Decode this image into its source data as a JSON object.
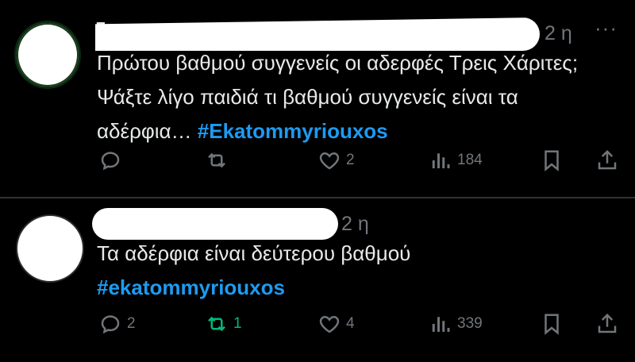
{
  "tweets": [
    {
      "author_fragment": "P",
      "time": "2 η",
      "more": "···",
      "text": "Πρώτου βαθμού συγγενείς οι αδερφές Τρεις Χάριτες; Ψάξτε λίγο παιδιά τι βαθμού συγγενείς είναι τα αδέρφια… ",
      "hashtag": "#Ekatommyriouxos",
      "replies": "",
      "retweets": "",
      "likes": "2",
      "views": "184"
    },
    {
      "time": "2 η",
      "text": "Τα αδέρφια είναι δεύτερου βαθμού",
      "hashtag": "#ekatommyriouxos",
      "replies": "2",
      "retweets": "1",
      "likes": "4",
      "views": "339"
    }
  ],
  "icons": {
    "reply": "reply-icon",
    "retweet": "retweet-icon",
    "like": "heart-icon",
    "views": "views-icon",
    "bookmark": "bookmark-icon",
    "share": "share-icon"
  },
  "colors": {
    "hashtag": "#1d9bf0",
    "muted": "#71767b",
    "retweet_active": "#00ba7c"
  }
}
